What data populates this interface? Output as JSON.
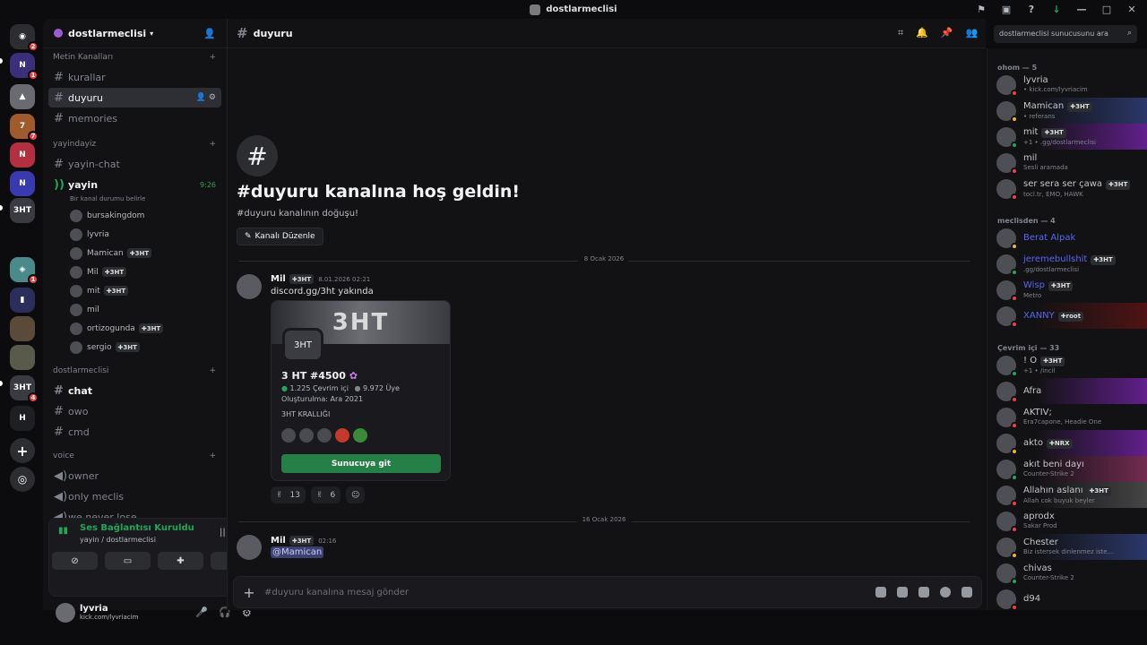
{
  "window": {
    "title": "dostlarmeclisi"
  },
  "server": {
    "name": "dostlarmeclisi"
  },
  "server_badges": [
    "2",
    "1",
    "7",
    "1",
    "4",
    "1"
  ],
  "sidebar": {
    "cat_text": "Metin Kanalları",
    "cat_stream": "yayindayiz",
    "cat_server": "dostlarmeclisi",
    "cat_voice": "voice",
    "text_channels": [
      "kurallar",
      "duyuru",
      "memories"
    ],
    "stream_channels": [
      "yayin-chat"
    ],
    "voice_live": {
      "name": "yayin",
      "time": "9:26",
      "status": "Bir kanal durumu belirle"
    },
    "voice_users": [
      {
        "name": "bursakingdom",
        "tag": ""
      },
      {
        "name": "lyvria",
        "tag": ""
      },
      {
        "name": "Mamican",
        "tag": "3HT"
      },
      {
        "name": "Mil",
        "tag": "3HT"
      },
      {
        "name": "mit",
        "tag": "3HT"
      },
      {
        "name": "mil",
        "tag": ""
      },
      {
        "name": "ortizogunda",
        "tag": "3HT"
      },
      {
        "name": "sergio",
        "tag": "3HT"
      }
    ],
    "server_channels": [
      "chat",
      "owo",
      "cmd"
    ],
    "voice_channels": [
      "owner",
      "only meclis",
      "we never lose."
    ]
  },
  "voice_panel": {
    "status": "Ses Bağlantısı Kuruldu",
    "sub": "yayin / dostlarmeclisi"
  },
  "user_panel": {
    "name": "lyvria",
    "activity": "kick.com/lyvriacim"
  },
  "channel": {
    "name": "duyuru",
    "search_placeholder": "dostlarmeclisi sunucusunu ara"
  },
  "welcome": {
    "icon": "#",
    "title": "#duyuru kanalına hoş geldin!",
    "sub": "#duyuru kanalının doğuşu!",
    "edit": "Kanalı Düzenle"
  },
  "dividers": [
    "8 Ocak 2026",
    "16 Ocak 2026"
  ],
  "messages": [
    {
      "author": "Mil",
      "tag": "3HT",
      "time": "8.01.2026 02:21",
      "text": "discord.gg/3ht yakında"
    },
    {
      "author": "Mil",
      "tag": "3HT",
      "time": "02:16",
      "text": "@Mamican"
    }
  ],
  "invite": {
    "banner": "3HT",
    "icon_text": "3HT",
    "name": "3 HT #4500",
    "online": "1.225 Çevrim içi",
    "members": "9.972 Üye",
    "created": "Oluşturulma: Ara 2021",
    "desc": "3HT KRALLIĞI",
    "join": "Sunucuya git"
  },
  "reactions": [
    {
      "emoji": "✌",
      "count": "13"
    },
    {
      "emoji": "✌",
      "count": "6"
    }
  ],
  "composer": {
    "placeholder": "#duyuru kanalına mesaj gönder"
  },
  "member_groups": [
    {
      "title": "ohom — 5",
      "members": [
        {
          "name": "lyvria",
          "act": "• kick.com/lyvriacim",
          "tag": "",
          "color": "#c4c6cb",
          "hl": ""
        },
        {
          "name": "Mamican",
          "act": "• referans",
          "tag": "3HT",
          "color": "#c4c6cb",
          "hl": "hl2"
        },
        {
          "name": "mit",
          "act": "+1 • .gg/dostlarmeclisi",
          "tag": "3HT",
          "color": "#c4c6cb",
          "hl": "hl"
        },
        {
          "name": "mil",
          "act": "Sesli aramada",
          "tag": "",
          "color": "#c4c6cb",
          "hl": ""
        },
        {
          "name": "ser sera ser çawa",
          "act": "tocl.tr, EMO, HAWK",
          "tag": "3HT",
          "color": "#c4c6cb",
          "hl": ""
        }
      ]
    },
    {
      "title": "meclisden — 4",
      "members": [
        {
          "name": "Berat Alpak",
          "act": "",
          "tag": "",
          "color": "#5865f2",
          "hl": ""
        },
        {
          "name": "jeremebullshit",
          "act": ".gg/dostlarmeclisi",
          "tag": "3HT",
          "color": "#5865f2",
          "hl": ""
        },
        {
          "name": "Wisp",
          "act": "Metro",
          "tag": "3HT",
          "color": "#5865f2",
          "hl": ""
        },
        {
          "name": "XANNY",
          "act": "",
          "tag": "root",
          "color": "#5865f2",
          "hl": "hl5"
        }
      ]
    },
    {
      "title": "Çevrim içi — 33",
      "members": [
        {
          "name": "! O",
          "act": "+1 • /incil",
          "tag": "3HT",
          "color": "#c4c6cb",
          "hl": ""
        },
        {
          "name": "Afra",
          "act": "",
          "tag": "",
          "color": "#c4c6cb",
          "hl": "hl"
        },
        {
          "name": "AKTIV;",
          "act": "Era7capone, Headie One",
          "tag": "",
          "color": "#c4c6cb",
          "hl": ""
        },
        {
          "name": "akto",
          "act": "",
          "tag": "NRX",
          "color": "#c4c6cb",
          "hl": "hl"
        },
        {
          "name": "akıt beni dayı",
          "act": "Counter-Strike 2",
          "tag": "",
          "color": "#c4c6cb",
          "hl": "hl3"
        },
        {
          "name": "Allahın aslanı",
          "act": "Allah cok buyuk beyler",
          "tag": "3HT",
          "color": "#c4c6cb",
          "hl": "hl4"
        },
        {
          "name": "aprodx",
          "act": "Sakar Prod",
          "tag": "",
          "color": "#c4c6cb",
          "hl": ""
        },
        {
          "name": "Chester",
          "act": "Biz istersek dinlenmez iste...",
          "tag": "",
          "color": "#c4c6cb",
          "hl": "hl2"
        },
        {
          "name": "chivas",
          "act": "Counter-Strike 2",
          "tag": "",
          "color": "#c4c6cb",
          "hl": ""
        },
        {
          "name": "d94",
          "act": "",
          "tag": "",
          "color": "#c4c6cb",
          "hl": ""
        }
      ]
    }
  ]
}
